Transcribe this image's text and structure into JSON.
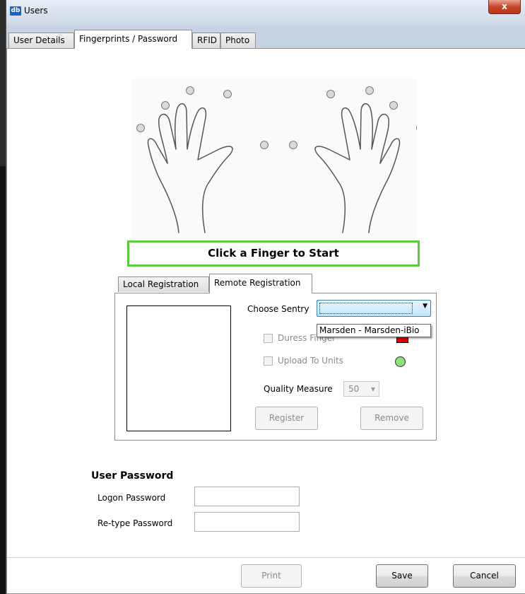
{
  "window": {
    "title": "Users",
    "logo_text": "db",
    "close_glyph": "x"
  },
  "tabs": [
    {
      "label": "User Details"
    },
    {
      "label": "Fingerprints / Password"
    },
    {
      "label": "RFID"
    },
    {
      "label": "Photo"
    }
  ],
  "active_tab": "Fingerprints / Password",
  "fingerprint": {
    "instruction": "Click a Finger to Start"
  },
  "registration": {
    "tabs": [
      {
        "label": "Local Registration"
      },
      {
        "label": "Remote Registration"
      }
    ],
    "active_tab": "Remote Registration",
    "choose_sentry_label": "Choose Sentry",
    "sentry_selected": "",
    "sentry_options": [
      "Marsden - Marsden-iBio"
    ],
    "duress_finger_label": "Duress Finger",
    "upload_to_units_label": "Upload To Units",
    "quality_measure_label": "Quality Measure",
    "quality_measure_value": "50",
    "register_label": "Register",
    "remove_label": "Remove",
    "duress_indicator_color": "#e00000",
    "upload_indicator_color": "#8ee07a"
  },
  "password": {
    "section_title": "User Password",
    "logon_label": "Logon Password",
    "retype_label": "Re-type Password"
  },
  "footer": {
    "print_label": "Print",
    "save_label": "Save",
    "cancel_label": "Cancel"
  },
  "colors": {
    "instruction_border": "#5dcb3e",
    "focus_border": "#3c7fb1"
  }
}
